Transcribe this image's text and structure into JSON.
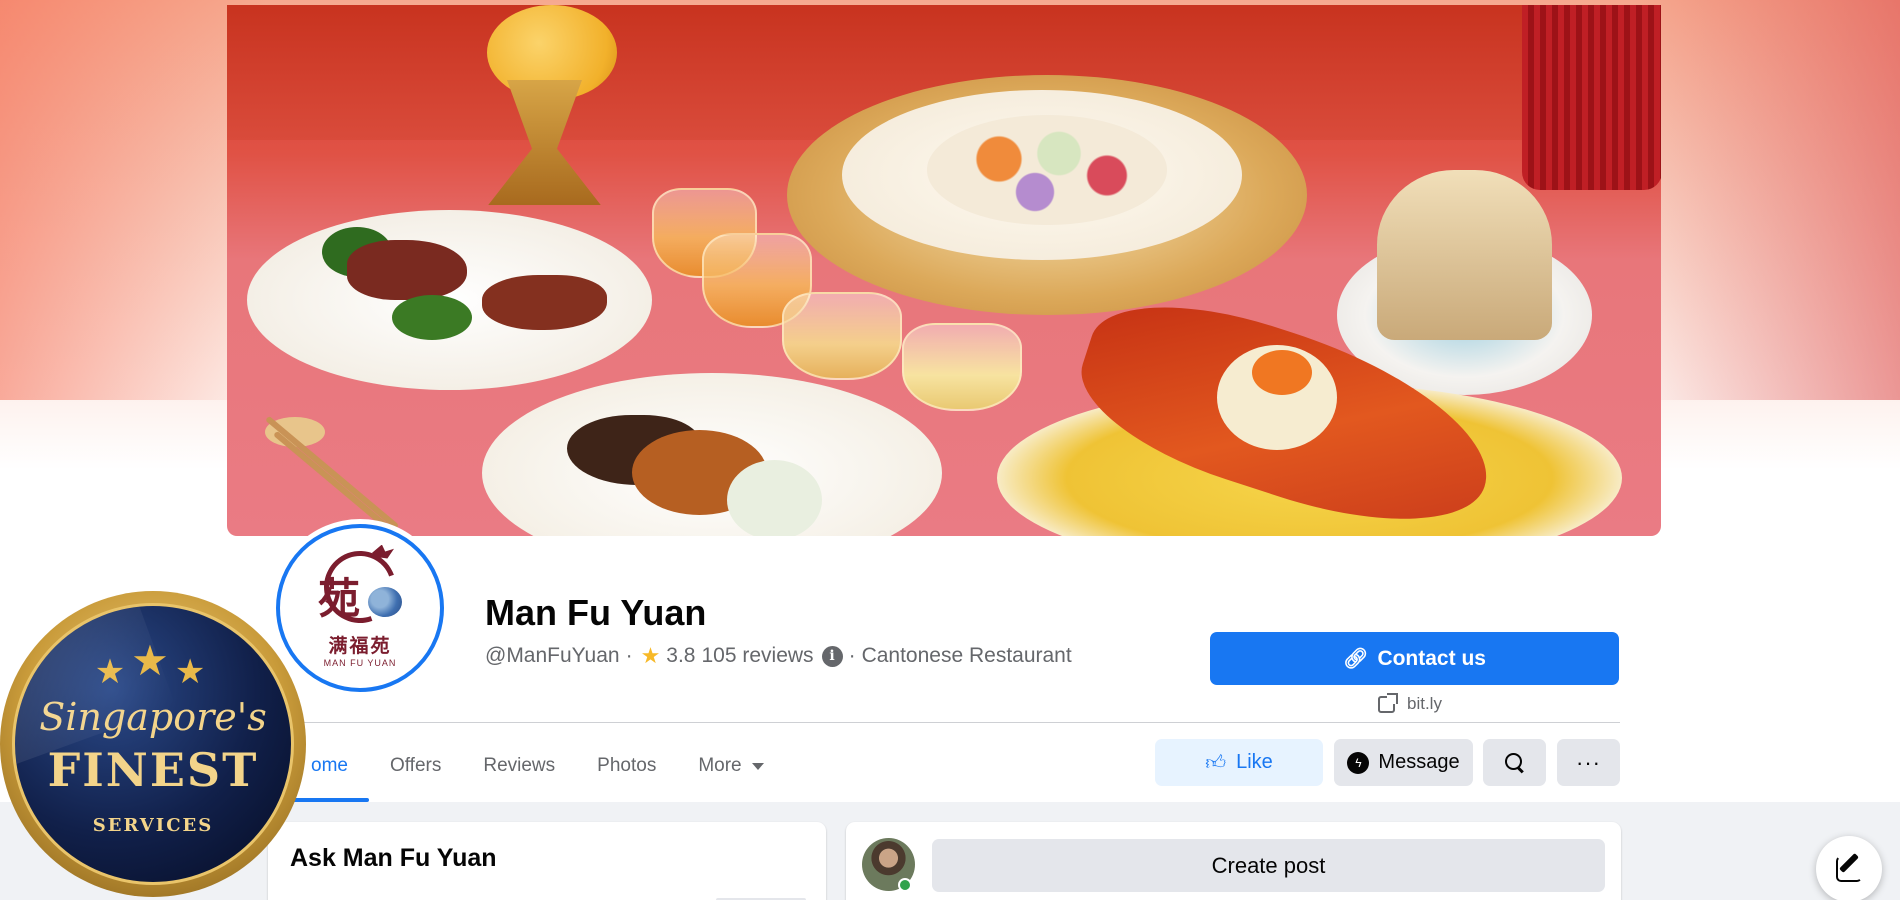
{
  "page": {
    "name": "Man Fu Yuan",
    "handle": "@ManFuYuan",
    "separator": "·",
    "rating": "3.8",
    "reviews_text": "105 reviews",
    "info_glyph": "i",
    "category": "Cantonese Restaurant"
  },
  "logo": {
    "glyph": "苑",
    "chinese_name": "满福苑",
    "english_name": "MAN FU YUAN"
  },
  "cta": {
    "contact_label": "Contact us",
    "contact_icon": "link-icon",
    "link_text": "bit.ly"
  },
  "tabs": [
    {
      "label": "ome",
      "active": true
    },
    {
      "label": "Offers",
      "active": false
    },
    {
      "label": "Reviews",
      "active": false
    },
    {
      "label": "Photos",
      "active": false
    },
    {
      "label": "More",
      "active": false
    }
  ],
  "actions": {
    "like_label": "Like",
    "message_label": "Message",
    "more_glyph": "···"
  },
  "cards": {
    "ask_title": "Ask Man Fu Yuan",
    "create_post_label": "Create post"
  },
  "badge": {
    "line1": "Singapore's",
    "line2": "FINEST",
    "line3": "SERVICES"
  },
  "colors": {
    "brand_blue": "#1877f2",
    "like_bg": "#e7f3ff",
    "secondary_btn_bg": "#e4e6eb",
    "online_green": "#31a24c",
    "logo_maroon": "#7b1d2e",
    "badge_gold": "#e9c46a",
    "badge_navy": "#11204a"
  }
}
